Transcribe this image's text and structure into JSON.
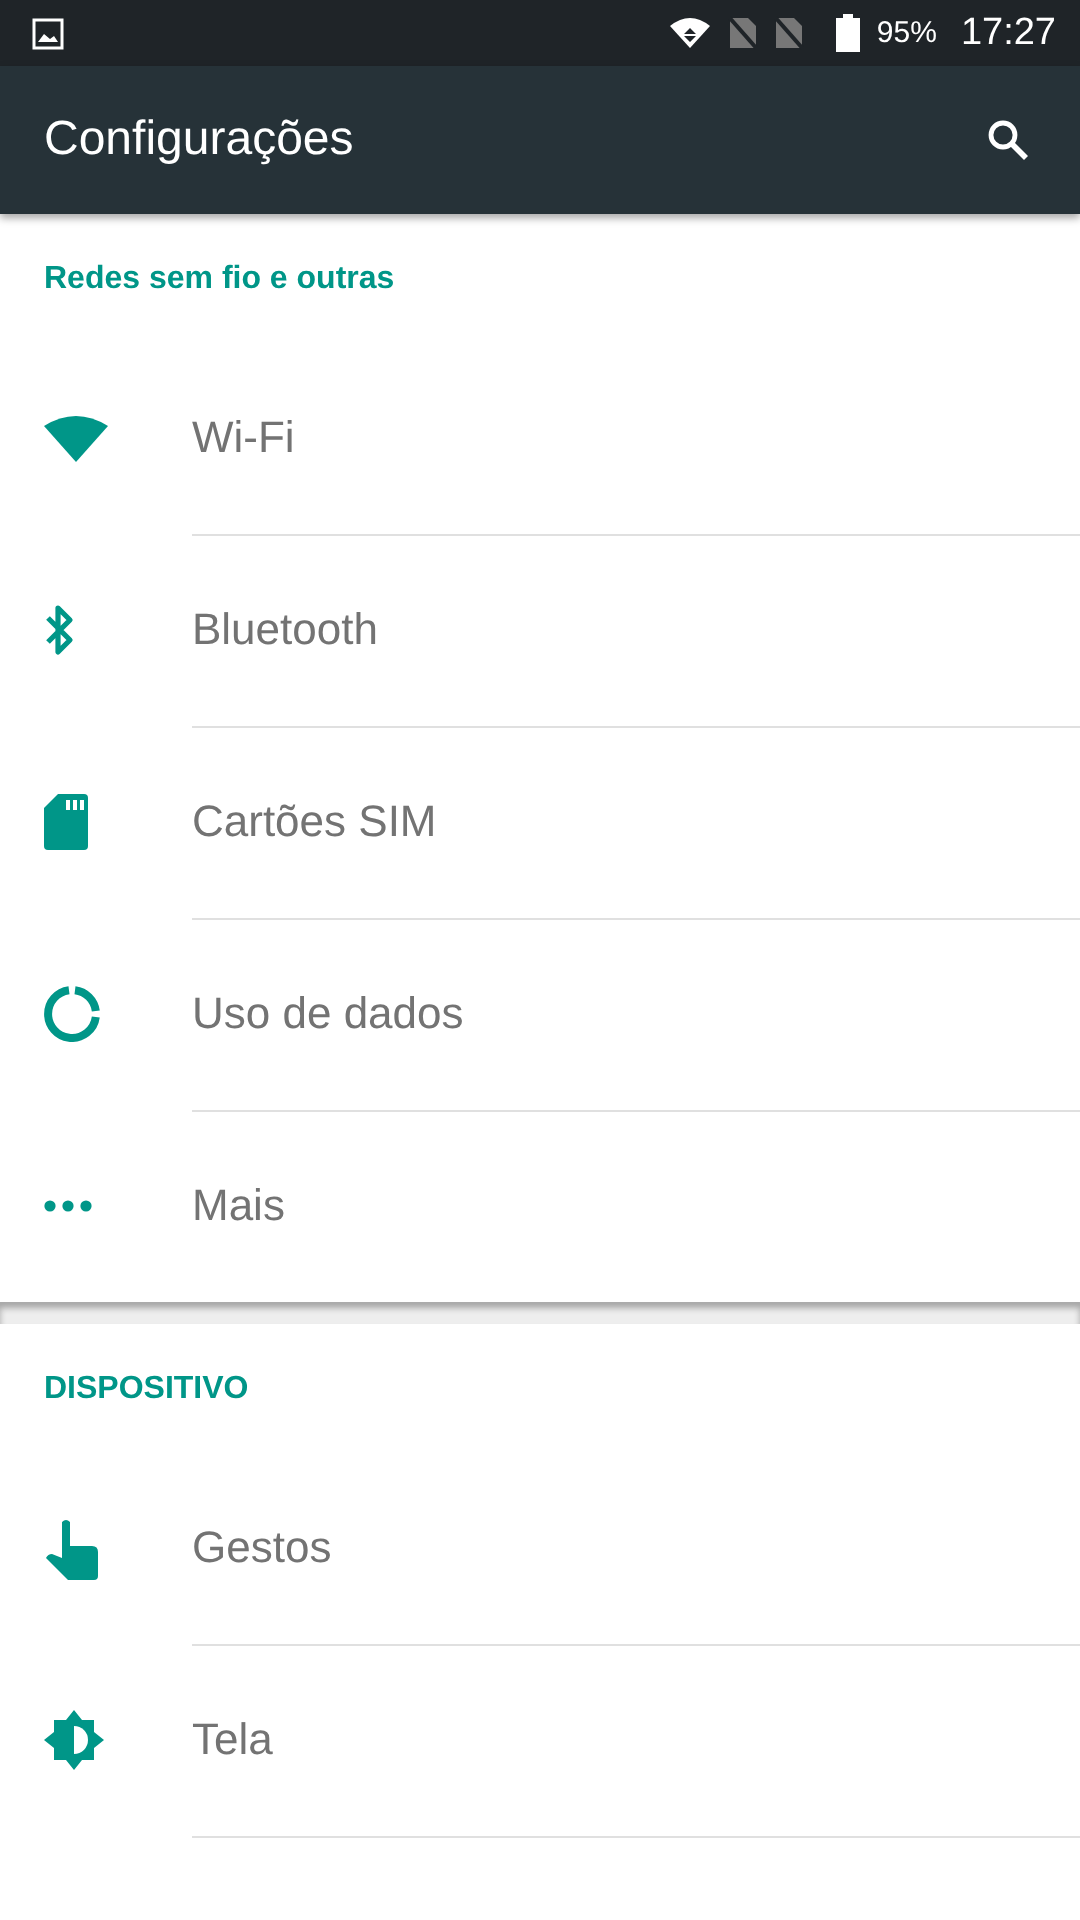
{
  "status_bar": {
    "battery": "95%",
    "time": "17:27"
  },
  "app_bar": {
    "title": "Configurações"
  },
  "sections": [
    {
      "title": "Redes sem fio e outras",
      "items": [
        {
          "label": "Wi-Fi",
          "kind": "wifi"
        },
        {
          "label": "Bluetooth",
          "kind": "bluetooth"
        },
        {
          "label": "Cartões SIM",
          "kind": "sim"
        },
        {
          "label": "Uso de dados",
          "kind": "data"
        },
        {
          "label": "Mais",
          "kind": "more"
        }
      ]
    },
    {
      "title": "DISPOSITIVO",
      "items": [
        {
          "label": "Gestos",
          "kind": "gesture"
        },
        {
          "label": "Tela",
          "kind": "display"
        }
      ]
    }
  ]
}
